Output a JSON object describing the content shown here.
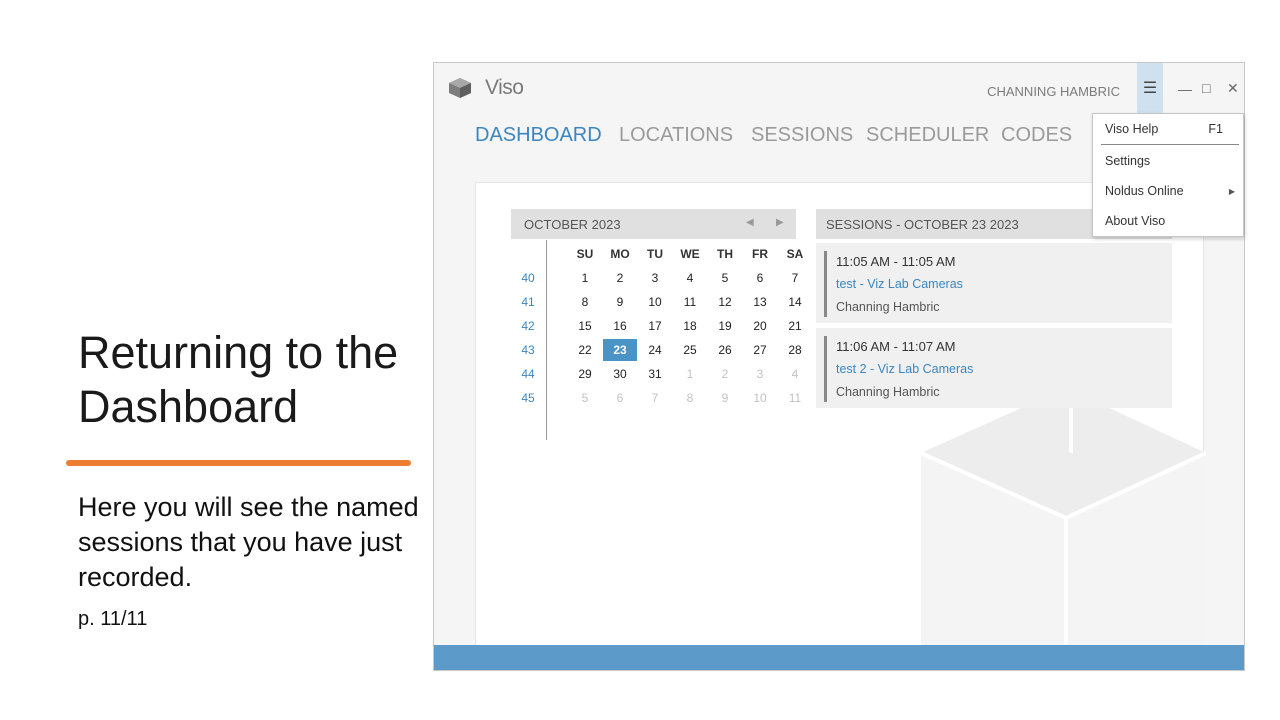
{
  "slide": {
    "title": "Returning to the Dashboard",
    "body": "Here you will see the named sessions that you have just recorded.",
    "page": "p. 11/11",
    "accent_color": "#ed7d31"
  },
  "app": {
    "name": "Viso",
    "user": "CHANNING HAMBRIC",
    "menu_icon": "hamburger-icon",
    "window_controls": [
      "minimize-icon",
      "maximize-icon",
      "close-icon"
    ],
    "accent_color": "#3a86c0",
    "statusbar_color": "#5b9ac9"
  },
  "nav": {
    "tabs": [
      {
        "label": "DASHBOARD",
        "active": true
      },
      {
        "label": "LOCATIONS",
        "active": false
      },
      {
        "label": "SESSIONS",
        "active": false
      },
      {
        "label": "SCHEDULER",
        "active": false
      },
      {
        "label": "CODES",
        "active": false
      }
    ]
  },
  "calendar": {
    "month_label": "OCTOBER 2023",
    "days_of_week": [
      "SU",
      "MO",
      "TU",
      "WE",
      "TH",
      "FR",
      "SA"
    ],
    "weeks": [
      {
        "week": "40",
        "days": [
          "1",
          "2",
          "3",
          "4",
          "5",
          "6",
          "7"
        ]
      },
      {
        "week": "41",
        "days": [
          "8",
          "9",
          "10",
          "11",
          "12",
          "13",
          "14"
        ]
      },
      {
        "week": "42",
        "days": [
          "15",
          "16",
          "17",
          "18",
          "19",
          "20",
          "21"
        ]
      },
      {
        "week": "43",
        "days": [
          "22",
          "23",
          "24",
          "25",
          "26",
          "27",
          "28"
        ]
      },
      {
        "week": "44",
        "days": [
          "29",
          "30",
          "31",
          "1",
          "2",
          "3",
          "4"
        ]
      },
      {
        "week": "45",
        "days": [
          "5",
          "6",
          "7",
          "8",
          "9",
          "10",
          "11"
        ]
      }
    ],
    "selected_day": "23"
  },
  "sessions": {
    "header": "SESSIONS - OCTOBER 23 2023",
    "items": [
      {
        "time": "11:05 AM - 11:05 AM",
        "name": "test - Viz Lab Cameras",
        "user": "Channing Hambric"
      },
      {
        "time": "11:06 AM - 11:07 AM",
        "name": "test 2 - Viz Lab Cameras",
        "user": "Channing Hambric"
      }
    ]
  },
  "menu": {
    "items": [
      {
        "label": "Viso Help",
        "shortcut": "F1"
      },
      {
        "label": "Settings",
        "shortcut": ""
      },
      {
        "label": "Noldus Online",
        "shortcut": "",
        "submenu": true
      },
      {
        "label": "About Viso",
        "shortcut": ""
      }
    ]
  }
}
